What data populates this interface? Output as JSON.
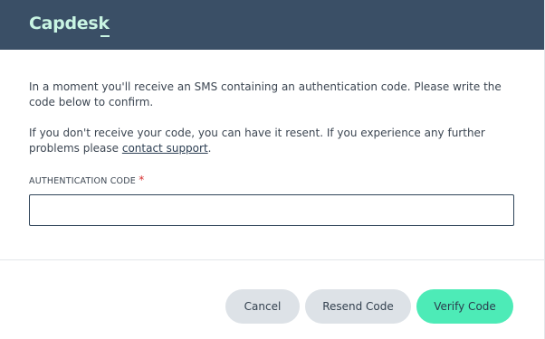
{
  "header": {
    "logo_text": "Capdesk"
  },
  "instructions": {
    "paragraph_1": "In a moment you'll receive an SMS containing an authentication code. Please write the code below to confirm.",
    "paragraph_2_prefix": "If you don't receive your code, you can have it resent. If you experience any further problems please ",
    "contact_link": "contact support",
    "paragraph_2_suffix": "."
  },
  "form": {
    "code_label": "AUTHENTICATION CODE",
    "required_marker": "*",
    "code_value": ""
  },
  "footer": {
    "cancel_label": "Cancel",
    "resend_label": "Resend Code",
    "verify_label": "Verify Code"
  },
  "colors": {
    "header_bg": "#3a4f66",
    "logo": "#c9f5e3",
    "primary_button": "#4debb7",
    "secondary_button": "#dde2e7",
    "required": "#d62e2e"
  }
}
